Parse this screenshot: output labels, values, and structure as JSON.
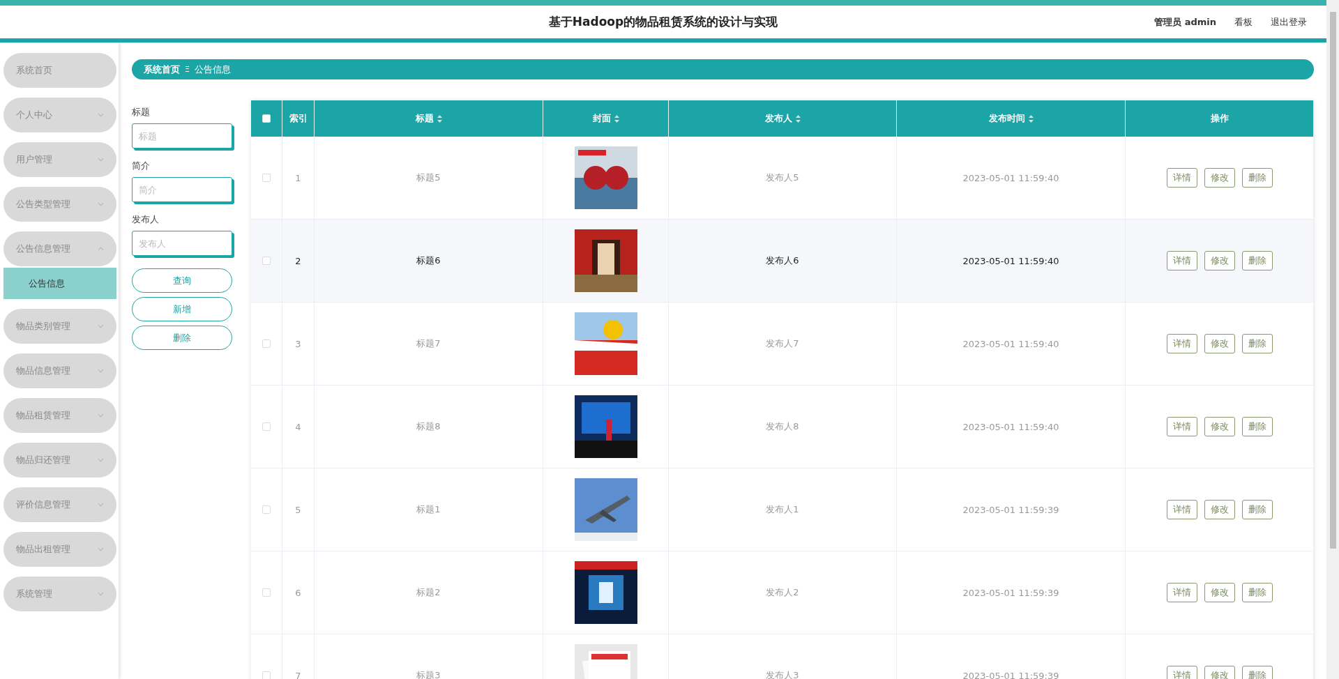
{
  "header": {
    "title": "基于Hadoop的物品租赁系统的设计与实现",
    "user": "管理员 admin",
    "links": [
      "看板",
      "退出登录"
    ]
  },
  "sidebar": {
    "items": [
      {
        "label": "系统首页"
      },
      {
        "label": "个人中心",
        "expanded": false
      },
      {
        "label": "用户管理",
        "expanded": false
      },
      {
        "label": "公告类型管理",
        "expanded": false
      },
      {
        "label": "公告信息管理",
        "expanded": true,
        "children": [
          {
            "label": "公告信息",
            "selected": true
          }
        ]
      },
      {
        "label": "物品类别管理",
        "expanded": false
      },
      {
        "label": "物品信息管理",
        "expanded": false
      },
      {
        "label": "物品租赁管理",
        "expanded": false
      },
      {
        "label": "物品归还管理",
        "expanded": false
      },
      {
        "label": "评价信息管理",
        "expanded": false
      },
      {
        "label": "物品出租管理",
        "expanded": false
      },
      {
        "label": "系统管理",
        "expanded": false
      }
    ]
  },
  "breadcrumb": {
    "items": [
      "系统首页",
      "公告信息"
    ],
    "separator": "Ξ"
  },
  "search": {
    "fields": [
      {
        "label": "标题",
        "placeholder": "标题"
      },
      {
        "label": "简介",
        "placeholder": "简介"
      },
      {
        "label": "发布人",
        "placeholder": "发布人"
      }
    ],
    "buttons": [
      "查询",
      "新增",
      "删除"
    ]
  },
  "table": {
    "select_all": {
      "checked": false
    },
    "columns": [
      {
        "label": "索引",
        "sortable": false
      },
      {
        "label": "标题",
        "sortable": true
      },
      {
        "label": "封面",
        "sortable": true
      },
      {
        "label": "发布人",
        "sortable": true
      },
      {
        "label": "发布时间",
        "sortable": true
      },
      {
        "label": "操作",
        "sortable": false
      }
    ],
    "rows": [
      {
        "checked": false,
        "hovered": false,
        "index": "1",
        "title": "标题5",
        "publisher": "发布人5",
        "time": "2023-05-01 11:59:40",
        "actions": [
          "详情",
          "修改",
          "删除"
        ]
      },
      {
        "checked": false,
        "hovered": true,
        "index": "2",
        "title": "标题6",
        "publisher": "发布人6",
        "time": "2023-05-01 11:59:40",
        "actions": [
          "详情",
          "修改",
          "删除"
        ]
      },
      {
        "checked": false,
        "hovered": false,
        "index": "3",
        "title": "标题7",
        "publisher": "发布人7",
        "time": "2023-05-01 11:59:40",
        "actions": [
          "详情",
          "修改",
          "删除"
        ]
      },
      {
        "checked": false,
        "hovered": false,
        "index": "4",
        "title": "标题8",
        "publisher": "发布人8",
        "time": "2023-05-01 11:59:40",
        "actions": [
          "详情",
          "修改",
          "删除"
        ]
      },
      {
        "checked": false,
        "hovered": false,
        "index": "5",
        "title": "标题1",
        "publisher": "发布人1",
        "time": "2023-05-01 11:59:39",
        "actions": [
          "详情",
          "修改",
          "删除"
        ]
      },
      {
        "checked": false,
        "hovered": false,
        "index": "6",
        "title": "标题2",
        "publisher": "发布人2",
        "time": "2023-05-01 11:59:39",
        "actions": [
          "详情",
          "修改",
          "删除"
        ]
      },
      {
        "checked": false,
        "hovered": false,
        "index": "7",
        "title": "标题3",
        "publisher": "发布人3",
        "time": "2023-05-01 11:59:39",
        "actions": [
          "详情",
          "修改",
          "删除"
        ]
      }
    ]
  }
}
